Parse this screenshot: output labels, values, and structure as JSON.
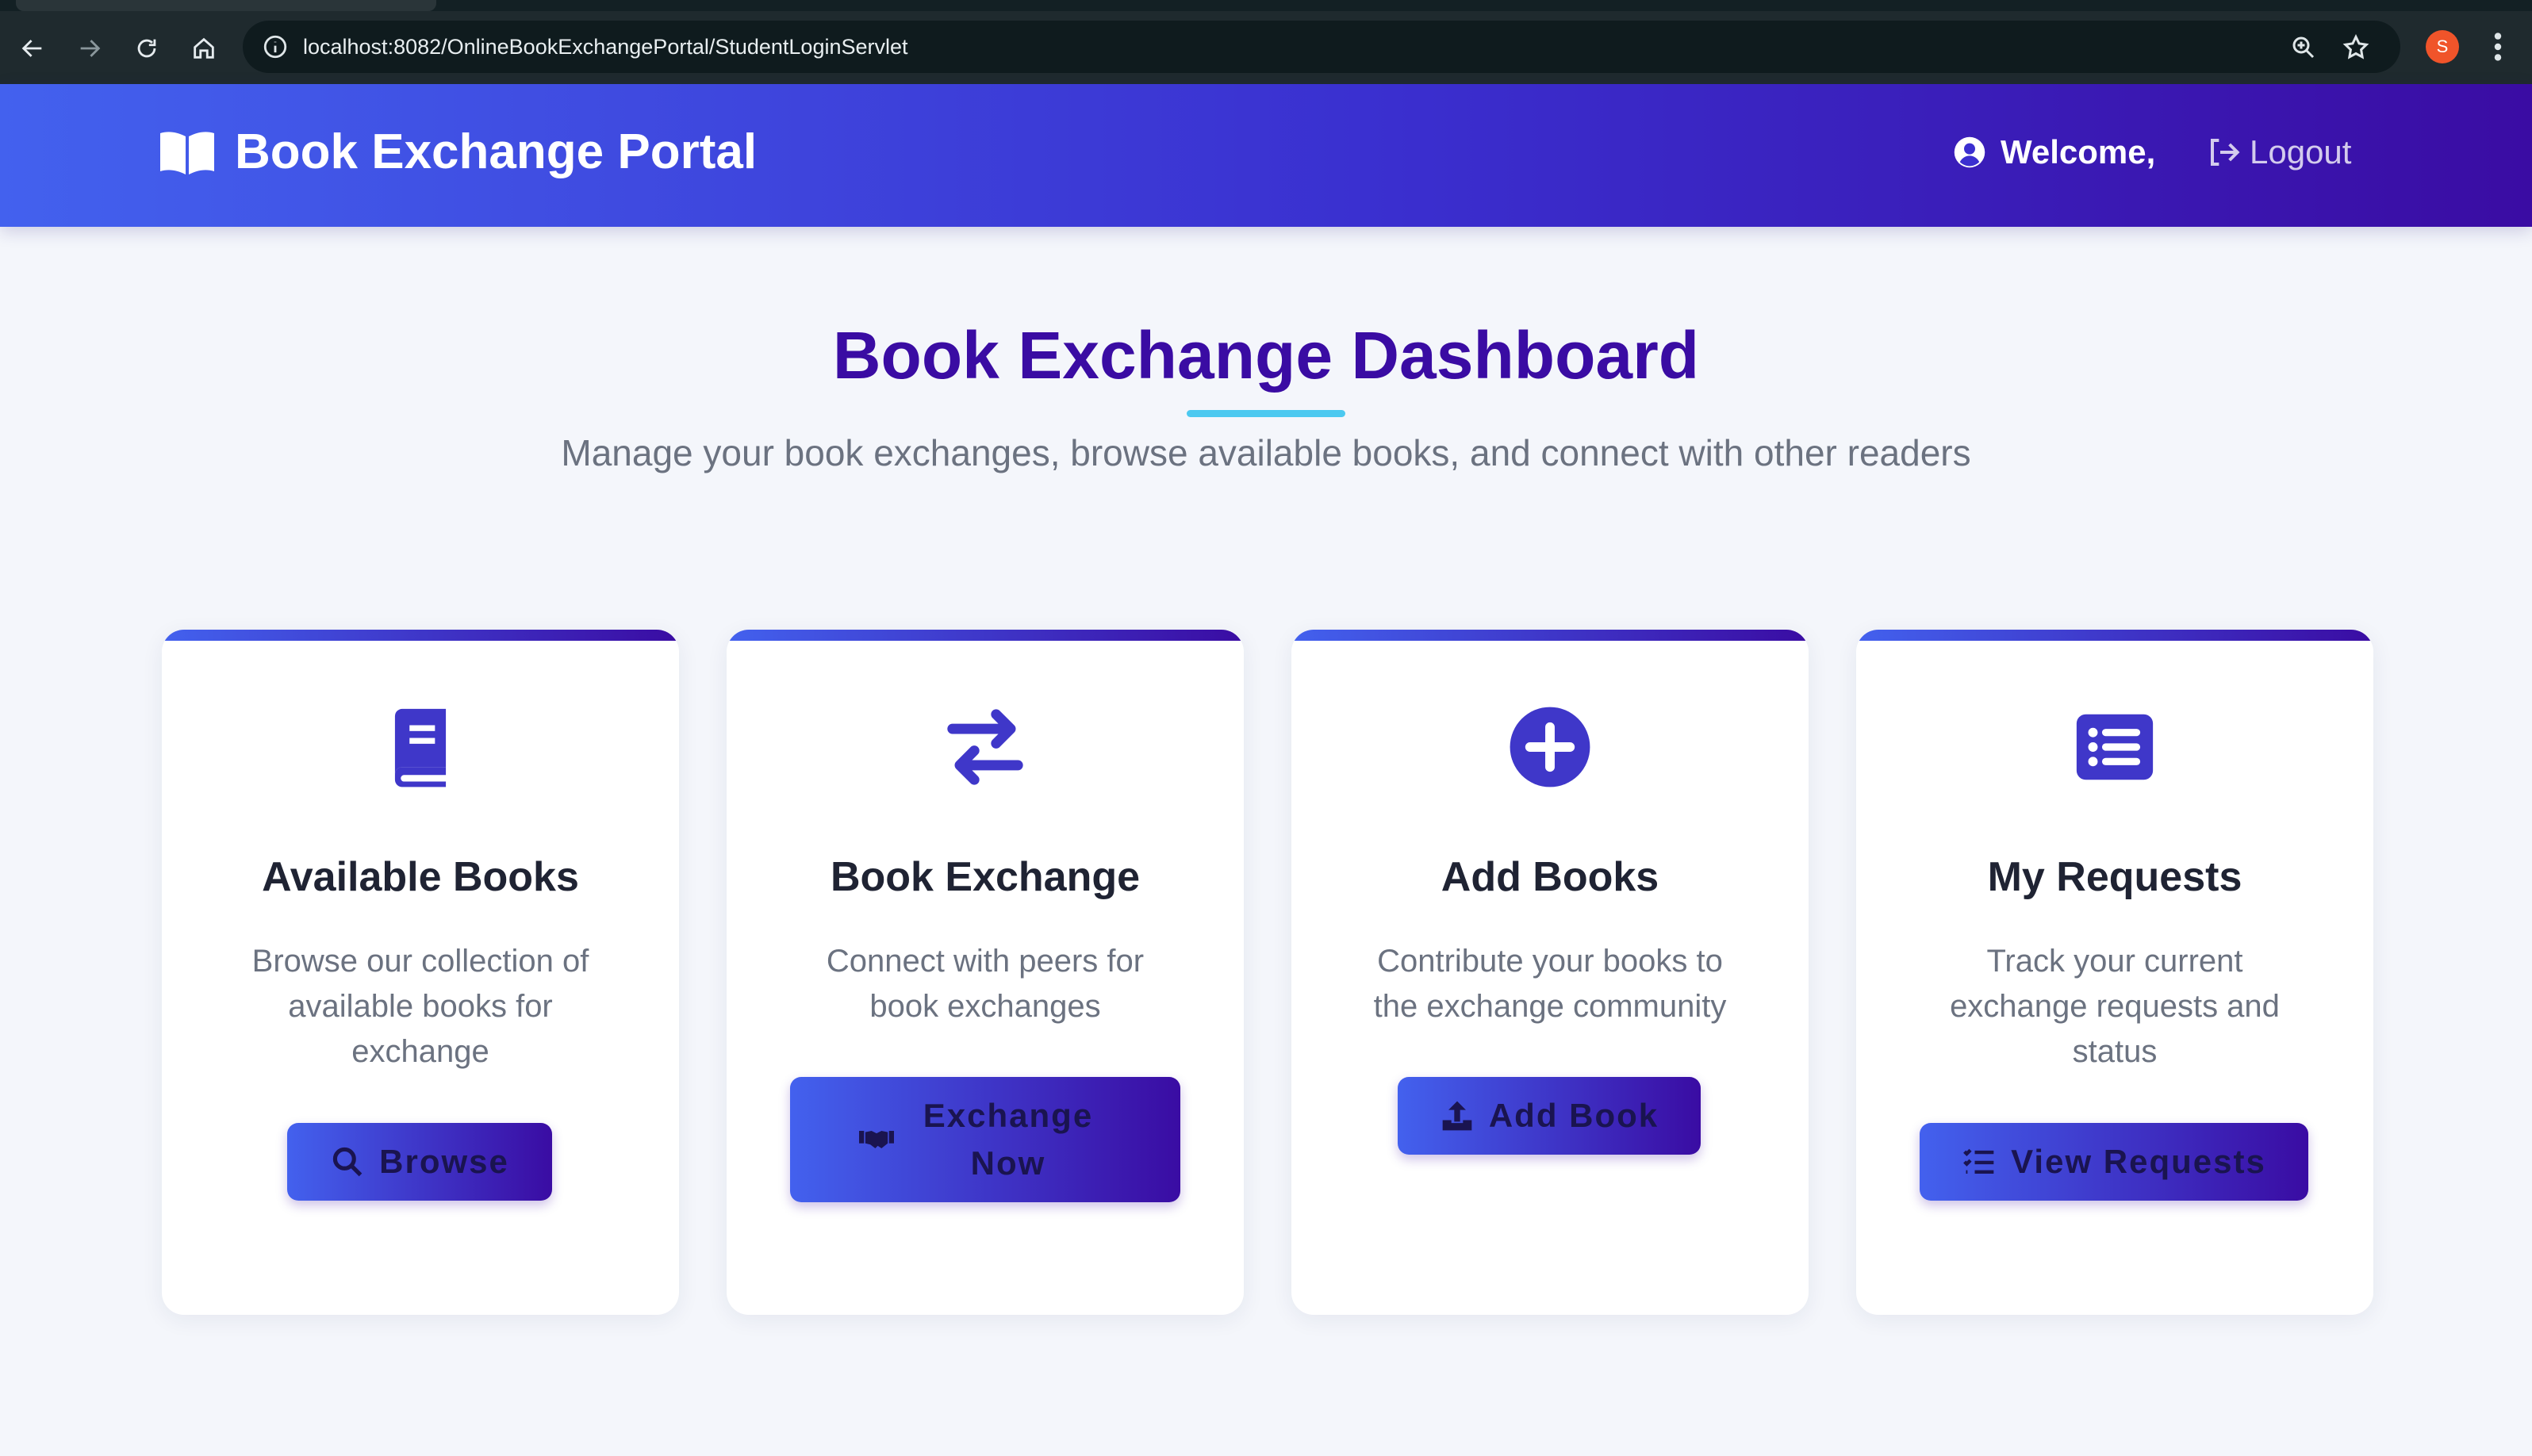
{
  "browser": {
    "url": "localhost:8082/OnlineBookExchangePortal/StudentLoginServlet",
    "profile_initial": "S"
  },
  "header": {
    "brand": "Book Exchange Portal",
    "welcome": "Welcome,",
    "logout": "Logout"
  },
  "dashboard": {
    "title": "Book Exchange Dashboard",
    "subtitle": "Manage your book exchanges, browse available books, and connect with other readers"
  },
  "cards": [
    {
      "icon": "book-icon",
      "title": "Available Books",
      "description": "Browse our collection of available books for exchange",
      "button_icon": "search-icon",
      "button": "Browse"
    },
    {
      "icon": "exchange-arrows-icon",
      "title": "Book Exchange",
      "description": "Connect with peers for book exchanges",
      "button_icon": "handshake-icon",
      "button": "Exchange Now"
    },
    {
      "icon": "plus-circle-icon",
      "title": "Add Books",
      "description": "Contribute your books to the exchange community",
      "button_icon": "upload-icon",
      "button": "Add Book"
    },
    {
      "icon": "list-icon",
      "title": "My Requests",
      "description": "Track your current exchange requests and status",
      "button_icon": "task-list-icon",
      "button": "View Requests"
    }
  ],
  "colors": {
    "primary": "#4361ee",
    "secondary": "#3a0ca3",
    "accent": "#4cc9f0",
    "background": "#f4f6fb"
  }
}
